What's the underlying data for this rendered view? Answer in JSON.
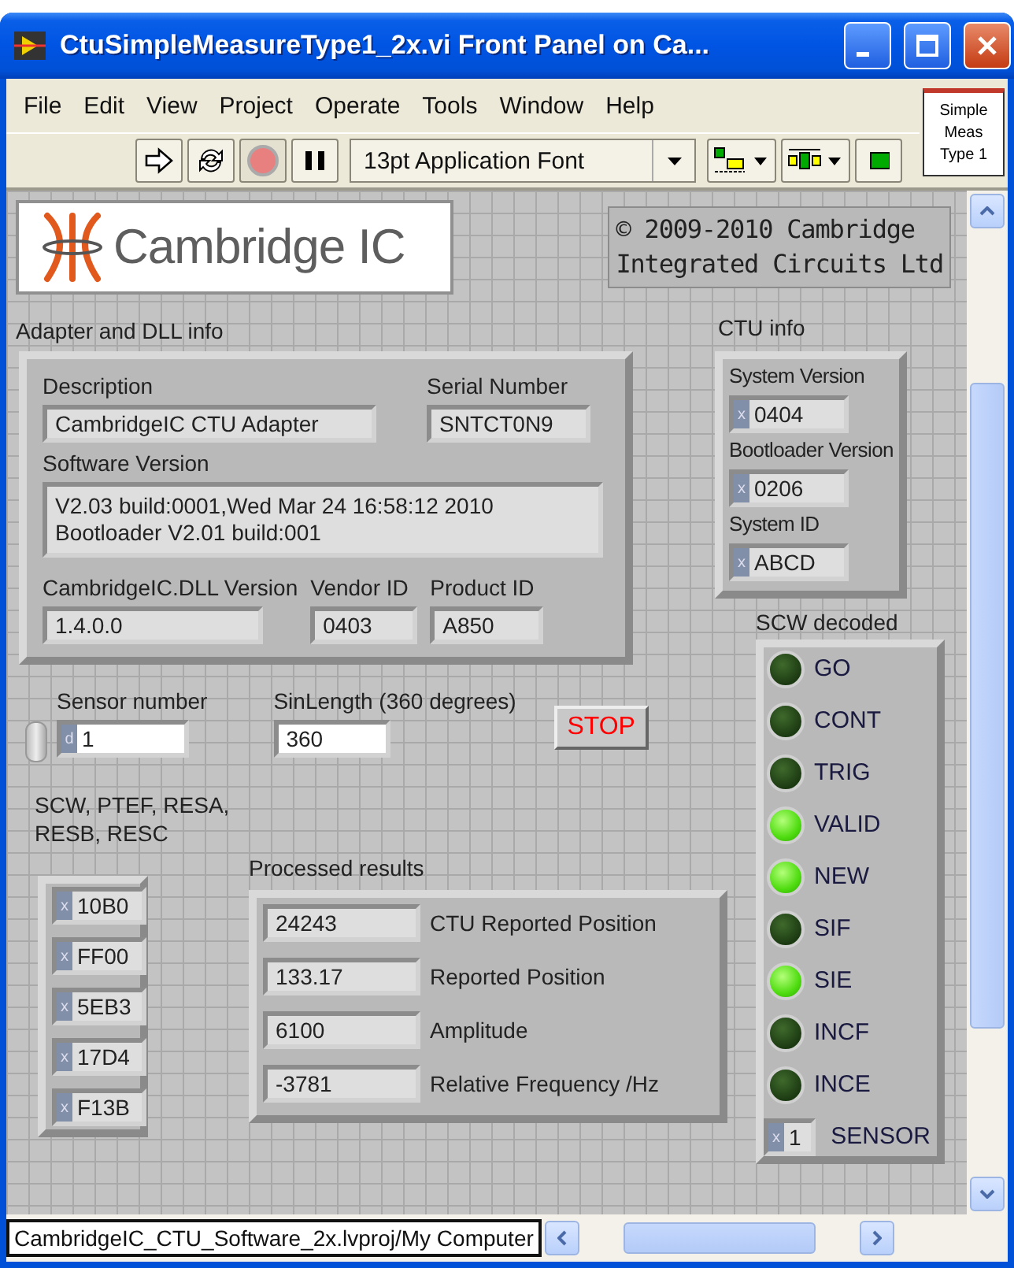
{
  "window": {
    "title": "CtuSimpleMeasureType1_2x.vi Front Panel on Ca..."
  },
  "menu": [
    "File",
    "Edit",
    "View",
    "Project",
    "Operate",
    "Tools",
    "Window",
    "Help"
  ],
  "toolbar": {
    "font": "13pt Application Font"
  },
  "vi_icon": {
    "lines": [
      "Simple",
      "Meas",
      "Type 1"
    ]
  },
  "logo": {
    "text": "Cambridge IC"
  },
  "copyright": {
    "lines": [
      "© 2009-2010 Cambridge",
      "Integrated Circuits Ltd"
    ]
  },
  "adapter": {
    "title": "Adapter and DLL info",
    "description": {
      "label": "Description",
      "value": "CambridgeIC CTU Adapter"
    },
    "serial_number": {
      "label": "Serial Number",
      "value": "SNTCT0N9"
    },
    "software_version": {
      "label": "Software Version",
      "lines": [
        "V2.03 build:0001,Wed Mar 24 16:58:12 2010",
        "Bootloader V2.01 build:001"
      ]
    },
    "dll_version": {
      "label": "CambridgeIC.DLL Version",
      "value": "1.4.0.0"
    },
    "vendor_id": {
      "label": "Vendor ID",
      "value": "0403"
    },
    "product_id": {
      "label": "Product ID",
      "value": "A850"
    }
  },
  "ctu_info": {
    "title": "CTU info",
    "fields": [
      {
        "label": "System Version",
        "radix": "x",
        "value": "0404"
      },
      {
        "label": "Bootloader Version",
        "radix": "x",
        "value": "0206"
      },
      {
        "label": "System ID",
        "radix": "x",
        "value": "ABCD"
      }
    ]
  },
  "sensor_number": {
    "label": "Sensor number",
    "radix": "d",
    "value": "1"
  },
  "sin_length": {
    "label": "SinLength (360 degrees)",
    "value": "360"
  },
  "stop_button": {
    "label": "STOP"
  },
  "registers": {
    "label": "SCW, PTEF, RESA, RESB, RESC",
    "values": [
      {
        "radix": "x",
        "value": "10B0"
      },
      {
        "radix": "x",
        "value": "FF00"
      },
      {
        "radix": "x",
        "value": "5EB3"
      },
      {
        "radix": "x",
        "value": "17D4"
      },
      {
        "radix": "x",
        "value": "F13B"
      }
    ]
  },
  "processed_results": {
    "title": "Processed results",
    "rows": [
      {
        "value": "24243",
        "label": "CTU Reported Position"
      },
      {
        "value": "133.17",
        "label": "Reported Position"
      },
      {
        "value": "6100",
        "label": "Amplitude"
      },
      {
        "value": "-3781",
        "label": "Relative Frequency /Hz"
      }
    ]
  },
  "scw_decoded": {
    "title": "SCW decoded",
    "flags": [
      {
        "label": "GO",
        "on": false
      },
      {
        "label": "CONT",
        "on": false
      },
      {
        "label": "TRIG",
        "on": false
      },
      {
        "label": "VALID",
        "on": true
      },
      {
        "label": "NEW",
        "on": true
      },
      {
        "label": "SIF",
        "on": false
      },
      {
        "label": "SIE",
        "on": true
      },
      {
        "label": "INCF",
        "on": false
      },
      {
        "label": "INCE",
        "on": false
      }
    ],
    "sensor": {
      "radix": "x",
      "value": "1",
      "label": "SENSOR"
    }
  },
  "status_bar": {
    "path": "CambridgeIC_CTU_Software_2x.lvproj/My Computer"
  }
}
